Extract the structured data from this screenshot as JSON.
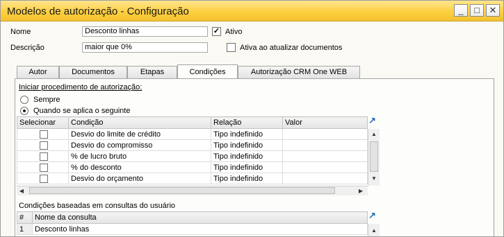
{
  "window": {
    "title": "Modelos de autorização - Configuração",
    "min_icon": "_",
    "max_icon": "□",
    "close_icon": "✕"
  },
  "form": {
    "nome_label": "Nome",
    "nome_value": "Desconto linhas",
    "ativo_label": "Ativo",
    "ativo_checked": true,
    "descricao_label": "Descrição",
    "descricao_value": "maior que 0%",
    "ativo_atualizar_label": "Ativa ao atualizar documentos",
    "ativo_atualizar_checked": false
  },
  "tabs": [
    "Autor",
    "Documentos",
    "Etapas",
    "Condições",
    "Autorização CRM One WEB"
  ],
  "active_tab": "Condições",
  "panel": {
    "iniciar_label": "Iniciar procedimento de autorização:",
    "radio_sempre": "Sempre",
    "radio_quando": "Quando se aplica o seguinte",
    "selected_radio": "Quando se aplica o seguinte",
    "grid_columns": [
      "Selecionar",
      "Condição",
      "Relação",
      "Valor"
    ],
    "grid_rows": [
      {
        "cond": "Desvio do limite de crédito",
        "rel": "Tipo indefinido",
        "valor": ""
      },
      {
        "cond": "Desvio do compromisso",
        "rel": "Tipo indefinido",
        "valor": ""
      },
      {
        "cond": "% de lucro bruto",
        "rel": "Tipo indefinido",
        "valor": ""
      },
      {
        "cond": "% do desconto",
        "rel": "Tipo indefinido",
        "valor": ""
      },
      {
        "cond": "Desvio do orçamento",
        "rel": "Tipo indefinido",
        "valor": ""
      }
    ],
    "consultas_label": "Condições baseadas em consultas do usuário",
    "consultas_columns": [
      "#",
      "Nome da consulta"
    ],
    "consultas_rows": [
      {
        "num": "1",
        "nome": "Desconto linhas"
      }
    ]
  },
  "colors": {
    "titlebar": "#fcce3c",
    "accent": "#2a6fb8"
  }
}
